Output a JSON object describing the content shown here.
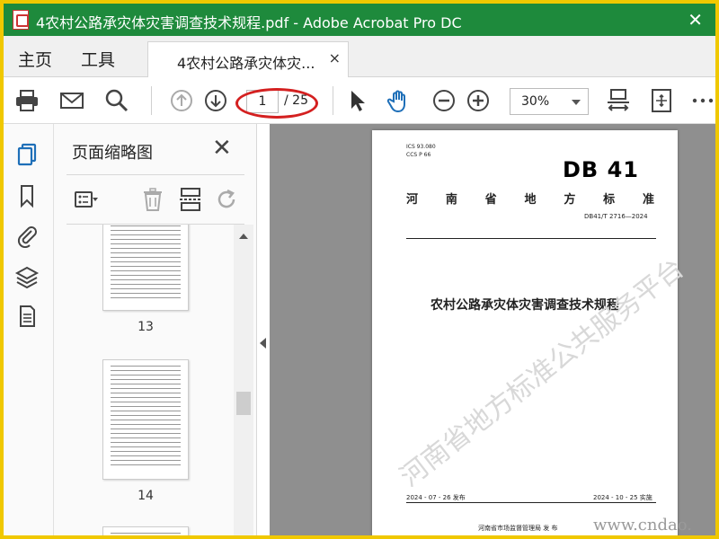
{
  "window": {
    "title": "4农村公路承灾体灾害调查技术规程.pdf - Adobe Acrobat Pro DC",
    "close_glyph": "✕"
  },
  "menubar": {
    "home_label": "主页",
    "tools_label": "工具",
    "doc_tab_label": "4农村公路承灾体灾...",
    "doc_tab_close": "×"
  },
  "toolbar": {
    "current_page": "1",
    "page_total": "/ 25",
    "zoom_value": "30%"
  },
  "panel": {
    "title": "页面缩略图",
    "close_glyph": "✕",
    "thumbnails": [
      "13",
      "14"
    ]
  },
  "document": {
    "ics_line": "ICS  93.080",
    "ccs_line": "CCS  P 66",
    "db_mark": "DB 41",
    "standard_chars": [
      "河",
      "南",
      "省",
      "地",
      "方",
      "标",
      "准"
    ],
    "code": "DB41/T 2716—2024",
    "title": "农村公路承灾体灾害调查技术规程",
    "publish_date": "2024 - 07 - 26 发布",
    "implement_date": "2024 - 10 - 25 实施",
    "issuer": "河南省市场监督管理局     发  布",
    "watermark": "河南省地方标准公共服务平台"
  },
  "footer": {
    "site_watermark": "www.cndao."
  },
  "colors": {
    "titlebar": "#1e8a3c",
    "frame": "#f0c800",
    "highlight": "#d42020",
    "rail_icon": "#1e6fb8"
  }
}
